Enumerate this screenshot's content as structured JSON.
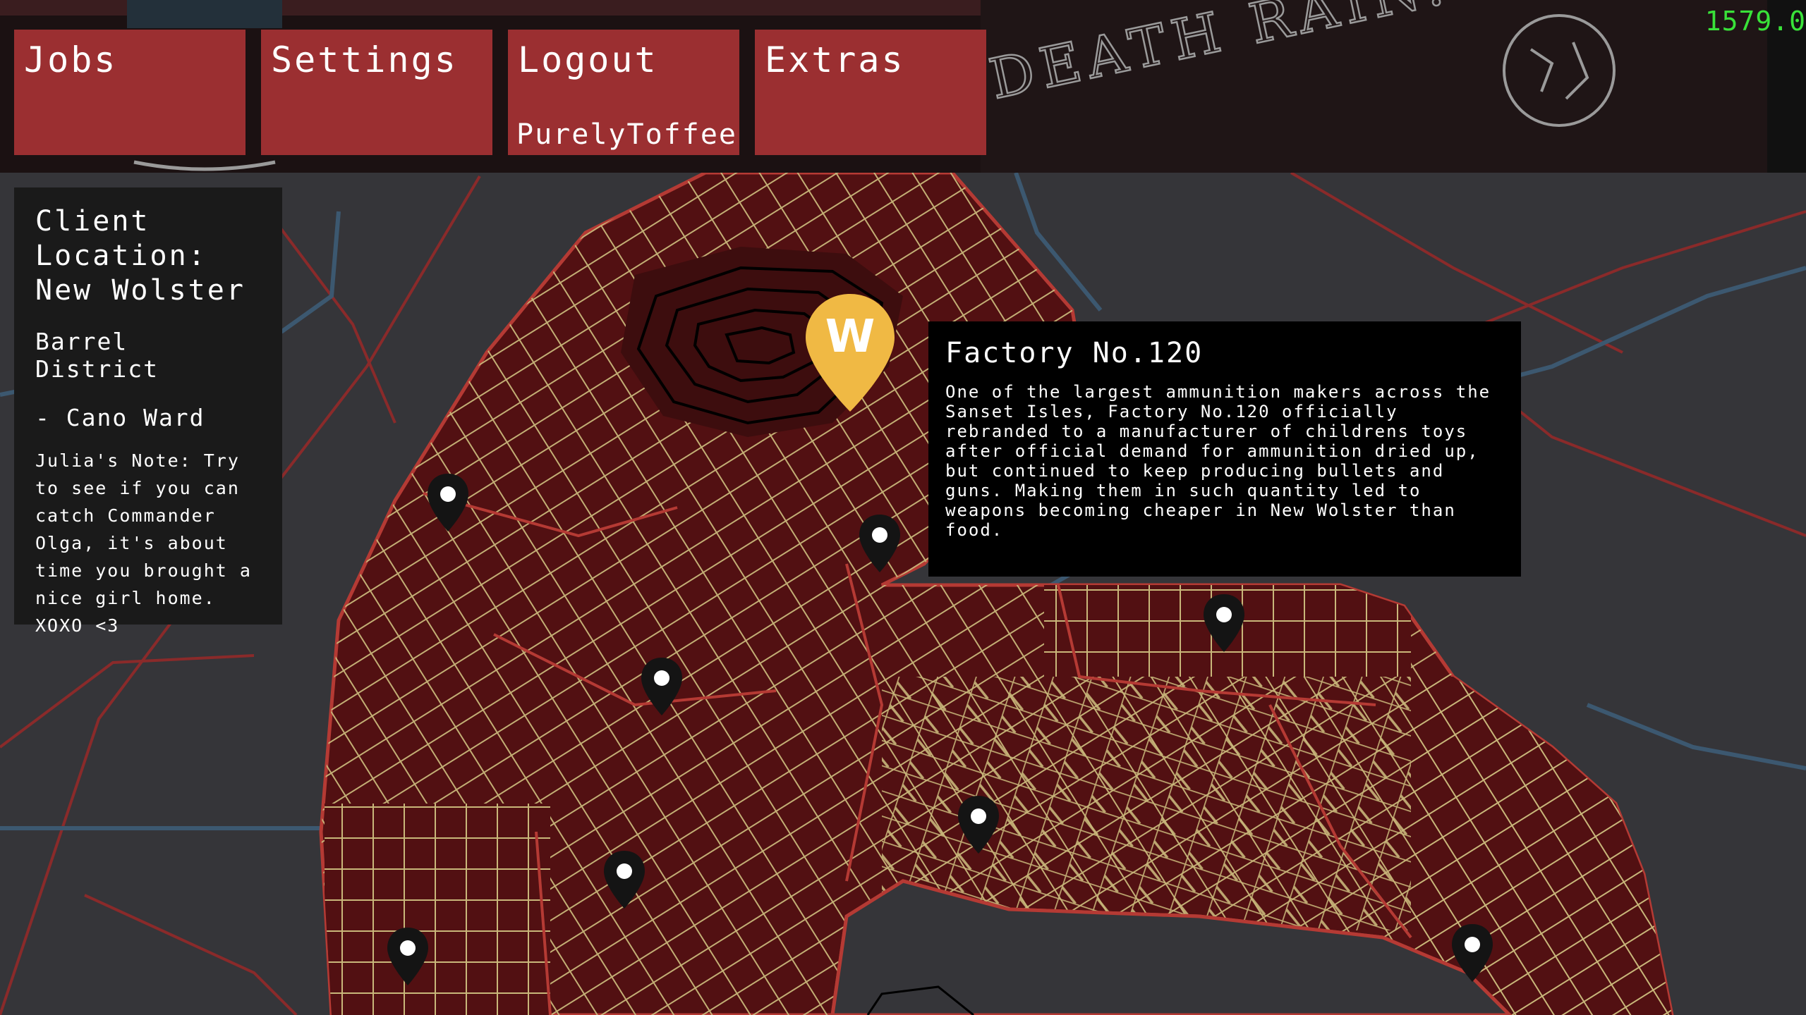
{
  "fps_counter": "1579.0",
  "menu": {
    "jobs_label": "Jobs",
    "settings_label": "Settings",
    "logout_label": "Logout",
    "logout_user": "PurelyToffee",
    "extras_label": "Extras"
  },
  "client_panel": {
    "heading": "Client Location: New Wolster",
    "district": "Barrel District",
    "ward": "- Cano Ward",
    "note": "Julia's Note: Try to see if you can catch Commander Olga, it's about time you brought a nice girl home. XOXO <3"
  },
  "tooltip": {
    "title": "Factory No.120",
    "body": "One of the largest ammunition makers across the Sanset Isles, Factory No.120 officially rebranded to a manufacturer of childrens toys after official demand for ammunition dried up, but continued to keep producing bullets and guns. Making them in such quantity led to weapons becoming cheaper in New Wolster than food."
  },
  "banner_sign": "DEATH RAIN: Hack 'n' Dine",
  "selected_marker_glyph": "W",
  "colors": {
    "menu_button": "#9b2f31",
    "city_fill": "#521012",
    "street": "#c9b77a",
    "selected_marker": "#f0b944",
    "marker": "#141414",
    "fps": "#39e239"
  }
}
